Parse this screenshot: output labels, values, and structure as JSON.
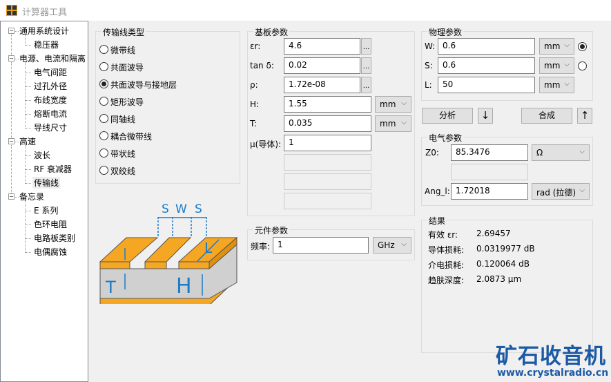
{
  "window": {
    "title": "计算器工具",
    "icon": "calculator-icon"
  },
  "tree": [
    {
      "label": "通用系统设计",
      "children": [
        "稳压器"
      ]
    },
    {
      "label": "电源、电流和隔离",
      "children": [
        "电气间距",
        "过孔外径",
        "布线宽度",
        "熔断电流",
        "导线尺寸"
      ]
    },
    {
      "label": "高速",
      "children": [
        "波长",
        "RF 衰减器",
        "传输线"
      ]
    },
    {
      "label": "备忘录",
      "children": [
        "E 系列",
        "色环电阻",
        "电路板类别",
        "电偶腐蚀"
      ]
    }
  ],
  "tree_selected": "传输线",
  "line_type": {
    "title": "传输线类型",
    "options": [
      "微带线",
      "共面波导",
      "共面波导与接地层",
      "矩形波导",
      "同轴线",
      "耦合微带线",
      "带状线",
      "双绞线"
    ],
    "selected": "共面波导与接地层"
  },
  "diagram": {
    "labels": {
      "s1": "S",
      "w": "W",
      "s2": "S",
      "l": "L",
      "t": "T",
      "h": "H"
    },
    "colors": {
      "copper": "#f5a623",
      "substrate": "#d0d0d0",
      "arrow": "#1a7bc9"
    }
  },
  "substrate": {
    "title": "基板参数",
    "rows": [
      {
        "label": "εr:",
        "value": "4.6",
        "more": "..."
      },
      {
        "label": "tan δ:",
        "value": "0.02",
        "more": "..."
      },
      {
        "label": "ρ:",
        "value": "1.72e-08",
        "more": "..."
      },
      {
        "label": "H:",
        "value": "1.55",
        "unit": "mm"
      },
      {
        "label": "T:",
        "value": "0.035",
        "unit": "mm"
      },
      {
        "label": "μ(导体):",
        "value": "1"
      }
    ]
  },
  "component": {
    "title": "元件参数",
    "freq_label": "频率:",
    "freq_value": "1",
    "freq_unit": "GHz"
  },
  "physical": {
    "title": "物理参数",
    "rows": [
      {
        "label": "W:",
        "value": "0.6",
        "unit": "mm"
      },
      {
        "label": "S:",
        "value": "0.6",
        "unit": "mm"
      },
      {
        "label": "L:",
        "value": "50",
        "unit": "mm"
      }
    ],
    "radio_selected": "W"
  },
  "actions": {
    "analyze": "分析",
    "synthesize": "合成",
    "down": "↓",
    "up": "↑"
  },
  "electrical": {
    "title": "电气参数",
    "z0_label": "Z0:",
    "z0_value": "85.3476",
    "z0_unit": "Ω",
    "ang_label": "Ang_l:",
    "ang_value": "1.72018",
    "ang_unit": "rad (拉德)"
  },
  "results": {
    "title": "结果",
    "rows": [
      {
        "label": "有效 εr:",
        "value": "2.69457"
      },
      {
        "label": "导体损耗:",
        "value": "0.0319977 dB"
      },
      {
        "label": "介电损耗:",
        "value": "0.120064 dB"
      },
      {
        "label": "趋肤深度:",
        "value": "2.0873 μm"
      }
    ]
  },
  "watermark": {
    "title": "矿石收音机",
    "url": "www.crystalradio.cn"
  }
}
